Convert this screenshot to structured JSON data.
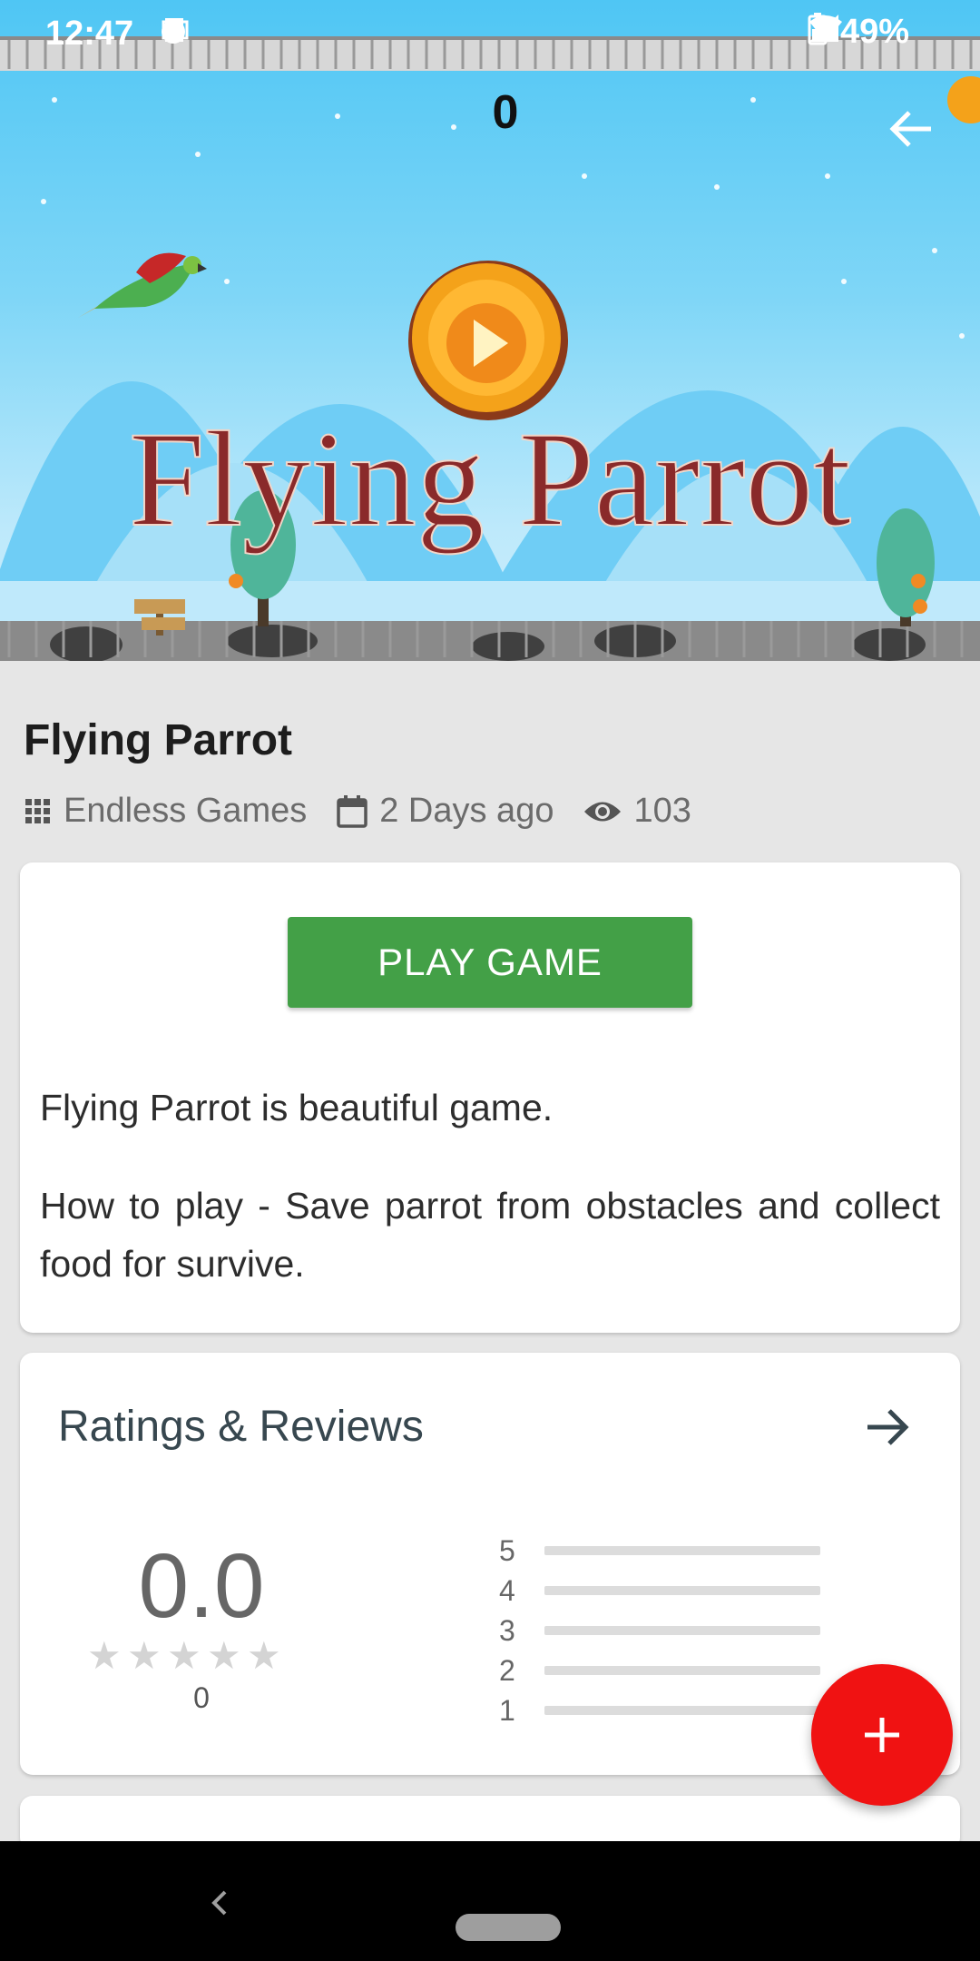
{
  "status_bar": {
    "time": "12:47",
    "battery": "49%"
  },
  "game": {
    "score": "0",
    "banner_title": "Flying Parrot"
  },
  "details": {
    "title": "Flying Parrot",
    "category": "Endless Games",
    "date": "2 Days ago",
    "views": "103"
  },
  "play_card": {
    "play_label": "PLAY GAME",
    "description": [
      "Flying Parrot is beautiful game.",
      "How to play - Save parrot from obstacles and collect food for survive."
    ]
  },
  "ratings": {
    "heading": "Ratings & Reviews",
    "average": "0.0",
    "count": "0",
    "star_levels": [
      "5",
      "4",
      "3",
      "2",
      "1"
    ]
  },
  "colors": {
    "play_button": "#43a047",
    "fab": "#f01212",
    "sky": "#4fc6f4"
  }
}
